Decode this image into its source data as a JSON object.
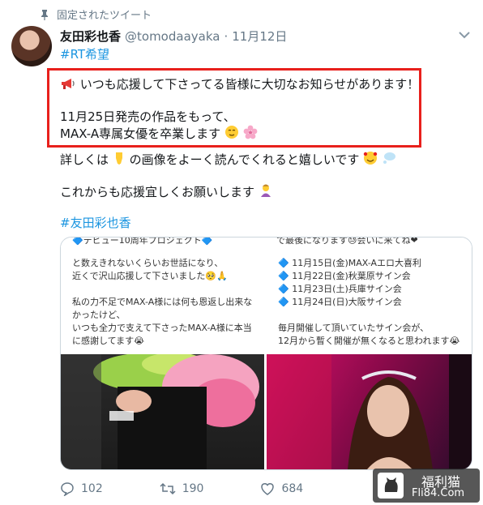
{
  "pinned": {
    "label": "固定されたツイート"
  },
  "user": {
    "name": "友田彩也香",
    "handle": "@tomodaayaka",
    "separator": "·",
    "date": "11月12日"
  },
  "tweet": {
    "hashtag_top": "#RT希望",
    "line1": "いつも応援して下さってる皆様に大切なお知らせがあります！",
    "line2": "11月25日発売の作品をもって、",
    "line3": "MAX-A専属女優を卒業します",
    "line4": "詳しくは",
    "line4_rest": "の画像をよーく読んでくれると嬉しいです",
    "line5": "これからも応援宜しくお願いします",
    "hashtag_bottom": "#友田彩也香"
  },
  "card": {
    "left_top": "🔷デビュー10周年プロジェクト🔷",
    "left_lines": [
      "と数えきれないくらいお世話になり、",
      "近くで沢山応援して下さいました🥺🙏",
      "",
      "私の力不足でMAX-A様には何も恩返し出来な",
      "かったけど、",
      "いつも全力で支えて下さったMAX-A様に本当",
      "に感謝してます😭"
    ],
    "right_top": "で最後になります😓会いに来てね❤",
    "right_events": [
      "🔷 11月15日(金)MAX-Aエロ大喜利",
      "🔷 11月22日(金)秋葉原サイン会",
      "🔷 11月23日(土)兵庫サイン会",
      "🔷 11月24日(日)大阪サイン会"
    ],
    "right_bottom": [
      "毎月開催して頂いていたサイン会が、",
      "12月から暫く開催が無くなると思われます😭"
    ]
  },
  "actions": {
    "replies": "102",
    "retweets": "190",
    "likes": "684"
  },
  "watermark": {
    "title": "福利猫",
    "site": "Fli84.Com"
  },
  "colors": {
    "link": "#1b95e0",
    "highlight": "#e8201c",
    "muted": "#657786"
  }
}
